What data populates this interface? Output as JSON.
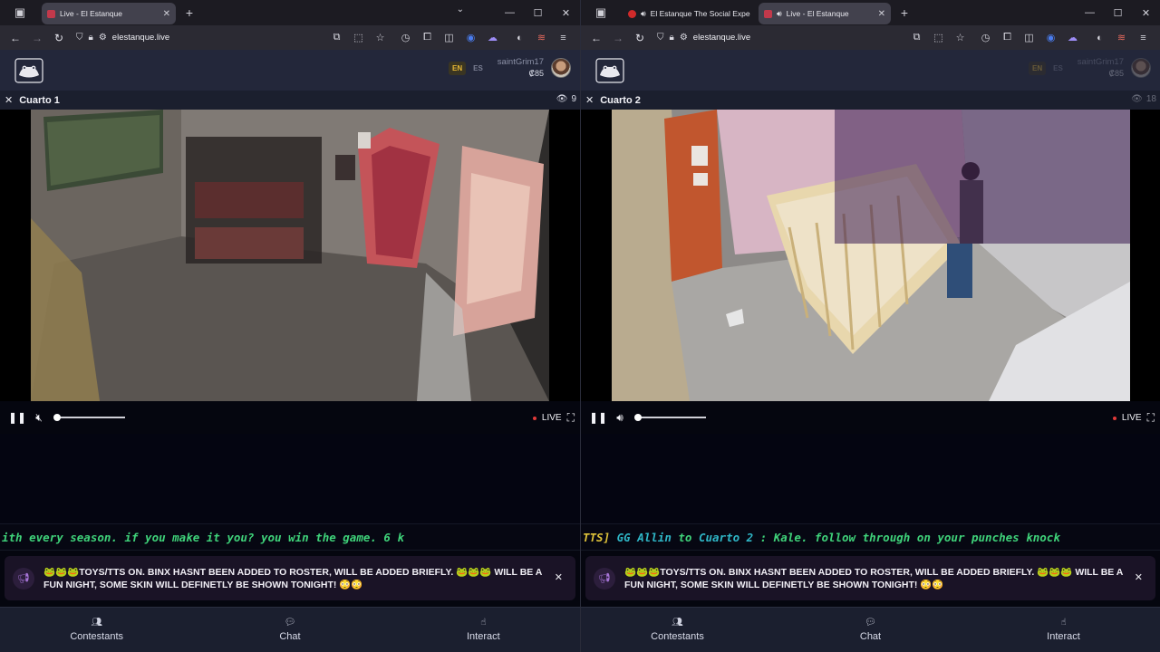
{
  "left": {
    "tabs": [
      {
        "label": "Live - El Estanque",
        "favicon_color": "#c2394b",
        "active": true
      }
    ],
    "url": "elestanque.live",
    "header": {
      "lang_en": "EN",
      "lang_es": "ES",
      "username": "saintGrim17",
      "balance": "₡85"
    },
    "room": {
      "name": "Cuarto 1",
      "viewers": "9"
    },
    "player": {
      "live_label": "LIVE",
      "muted": true,
      "volume": 0
    },
    "ticker": [
      {
        "text": "ith every season. if you make it you? you win the game. 6 k",
        "color": "green"
      }
    ],
    "announcement": "🐸🐸🐸TOYS/TTS ON. BINX HASNT BEEN ADDED TO ROSTER, WILL BE ADDED BRIEFLY. 🐸🐸🐸 WILL BE A FUN NIGHT, SOME SKIN WILL DEFINETLY BE SHOWN TONIGHT! 😳😳",
    "bottom_nav": [
      "Contestants",
      "Chat",
      "Interact"
    ]
  },
  "right": {
    "tabs": [
      {
        "label": "El Estanque The Social Expe",
        "favicon_color": "#d02a2a",
        "active": false
      },
      {
        "label": "Live - El Estanque",
        "favicon_color": "#c2394b",
        "active": true
      }
    ],
    "url": "elestanque.live",
    "header": {
      "lang_en": "EN",
      "lang_es": "ES",
      "username": "saintGrim17",
      "balance": "₡85"
    },
    "room": {
      "name": "Cuarto 2",
      "viewers": "18"
    },
    "player": {
      "live_label": "LIVE",
      "muted": false,
      "volume": 0
    },
    "ticker": [
      {
        "text": "TTS] ",
        "color": "yellow"
      },
      {
        "text": "GG Allin",
        "color": "cyan"
      },
      {
        "text": " to ",
        "color": "green"
      },
      {
        "text": "Cuarto 2",
        "color": "cyan"
      },
      {
        "text": " : Kale. follow through on your punches knock",
        "color": "green"
      }
    ],
    "announcement": "🐸🐸🐸TOYS/TTS ON. BINX HASNT BEEN ADDED TO ROSTER, WILL BE ADDED BRIEFLY. 🐸🐸🐸 WILL BE A FUN NIGHT, SOME SKIN WILL DEFINETLY BE SHOWN TONIGHT! 😳😳",
    "bottom_nav": [
      "Contestants",
      "Chat",
      "Interact"
    ]
  }
}
